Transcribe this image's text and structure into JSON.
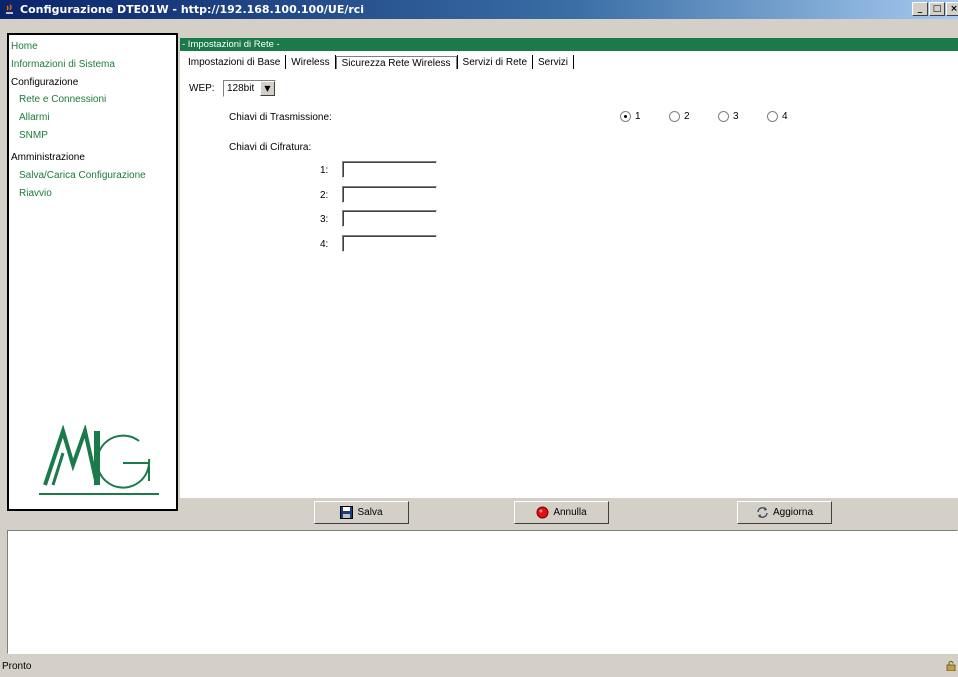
{
  "window": {
    "title": "Configurazione DTE01W - http://192.168.100.100/UE/rci",
    "controls": {
      "minimize": "_",
      "maximize": "□",
      "close": "×"
    }
  },
  "sidebar": {
    "items": [
      {
        "label": "Home",
        "kind": "link"
      },
      {
        "label": "Informazioni di Sistema",
        "kind": "link"
      },
      {
        "label": "Configurazione",
        "kind": "heading"
      },
      {
        "label": "Rete e Connessioni",
        "kind": "link"
      },
      {
        "label": "Allarmi",
        "kind": "link"
      },
      {
        "label": "SNMP",
        "kind": "link"
      },
      {
        "label": "Amministrazione",
        "kind": "heading"
      },
      {
        "label": "Salva/Carica Configurazione",
        "kind": "link"
      },
      {
        "label": "Riavvio",
        "kind": "link"
      }
    ],
    "logo_text": "MG"
  },
  "header": {
    "section_title": "- Impostazioni di Rete -"
  },
  "tabs": [
    {
      "label": "Impostazioni di Base"
    },
    {
      "label": "Wireless"
    },
    {
      "label": "Sicurezza Rete Wireless",
      "active": true
    },
    {
      "label": "Servizi di Rete"
    },
    {
      "label": "Servizi"
    }
  ],
  "form": {
    "wep_label": "WEP:",
    "wep_value": "128bit",
    "tx_keys_label": "Chiavi di Trasmissione:",
    "tx_key_options": [
      "1",
      "2",
      "3",
      "4"
    ],
    "tx_key_selected": "1",
    "cipher_keys_label": "Chiavi di Cifratura:",
    "cipher_keys": [
      {
        "label": "1:",
        "value": ""
      },
      {
        "label": "2:",
        "value": ""
      },
      {
        "label": "3:",
        "value": ""
      },
      {
        "label": "4:",
        "value": ""
      }
    ]
  },
  "buttons": {
    "save": "Salva",
    "cancel": "Annulla",
    "refresh": "Aggiorna"
  },
  "status": {
    "text": "Pronto"
  },
  "colors": {
    "link_green": "#1d7a3a",
    "header_green": "#1a7a4a",
    "titlebar_blue": "#0a246a"
  }
}
